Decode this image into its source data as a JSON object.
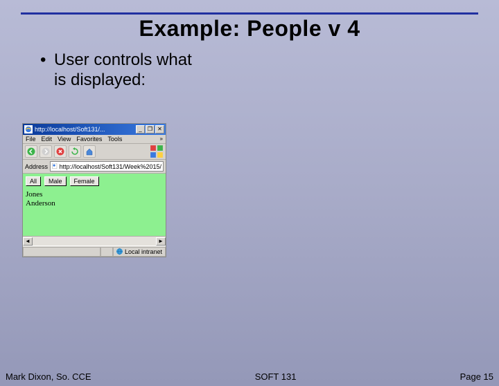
{
  "title": "Example: People v 4",
  "bullet": {
    "line1": "User controls what",
    "line2": "is displayed:"
  },
  "browser": {
    "title_text": "http://localhost/Soft131/...",
    "menu": {
      "file": "File",
      "edit": "Edit",
      "view": "View",
      "favorites": "Favorites",
      "tools": "Tools",
      "chev": "»"
    },
    "address_label": "Address",
    "address_value": "http://localhost/Soft131/Week%2015/",
    "buttons": {
      "all": "All",
      "male": "Male",
      "female": "Female"
    },
    "results": [
      "Jones",
      "Anderson"
    ],
    "status_zone": "Local intranet",
    "winbtns": {
      "min": "_",
      "max": "❐",
      "close": "✕"
    },
    "scroll": {
      "left": "◄",
      "right": "►"
    }
  },
  "footer": {
    "left": "Mark Dixon, So. CCE",
    "center": "SOFT 131",
    "right": "Page 15"
  }
}
